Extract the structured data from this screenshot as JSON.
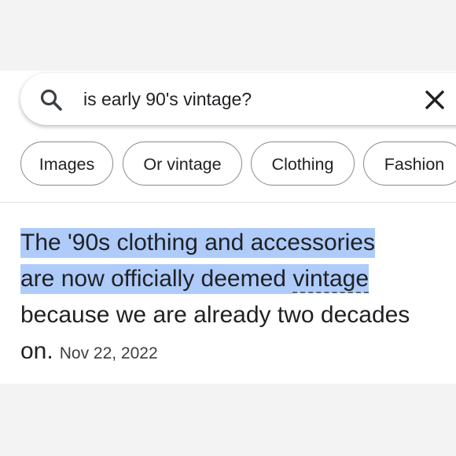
{
  "search": {
    "query": "is early 90's vintage?",
    "search_icon": "search-icon",
    "clear_icon": "close-icon"
  },
  "chips": [
    {
      "label": "Images"
    },
    {
      "label": "Or vintage"
    },
    {
      "label": "Clothing"
    },
    {
      "label": "Fashion"
    }
  ],
  "answer": {
    "highlighted_line_1": "The '90s clothing and accessories",
    "highlighted_line_2_part_a": "are now officially deemed ",
    "highlighted_line_2_part_b": "vintage",
    "line_3": "because we are already two decades",
    "line_4": "on.",
    "date": "Nov 22, 2022"
  },
  "colors": {
    "highlight": "#aecbfa",
    "text": "#202124",
    "chip_border": "#8a8a8a",
    "backdrop": "#f3f3f3"
  }
}
